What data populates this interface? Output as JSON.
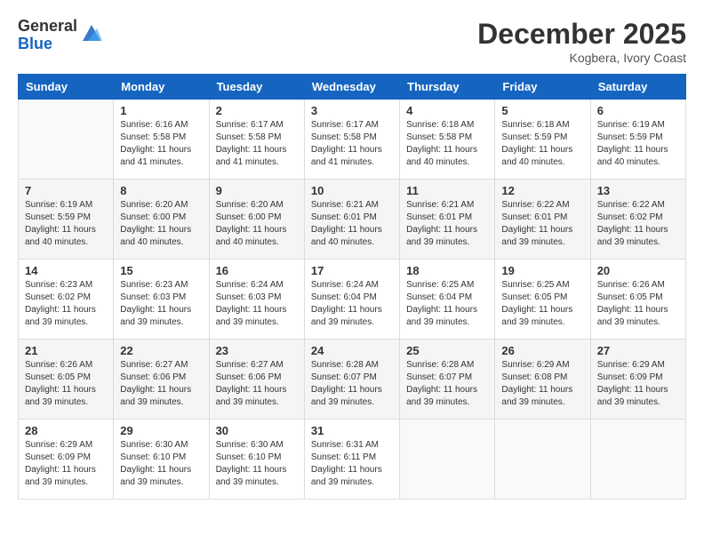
{
  "logo": {
    "general": "General",
    "blue": "Blue"
  },
  "header": {
    "month": "December 2025",
    "location": "Kogbera, Ivory Coast"
  },
  "weekdays": [
    "Sunday",
    "Monday",
    "Tuesday",
    "Wednesday",
    "Thursday",
    "Friday",
    "Saturday"
  ],
  "weeks": [
    [
      {
        "day": "",
        "info": ""
      },
      {
        "day": "1",
        "info": "Sunrise: 6:16 AM\nSunset: 5:58 PM\nDaylight: 11 hours and 41 minutes."
      },
      {
        "day": "2",
        "info": "Sunrise: 6:17 AM\nSunset: 5:58 PM\nDaylight: 11 hours and 41 minutes."
      },
      {
        "day": "3",
        "info": "Sunrise: 6:17 AM\nSunset: 5:58 PM\nDaylight: 11 hours and 41 minutes."
      },
      {
        "day": "4",
        "info": "Sunrise: 6:18 AM\nSunset: 5:58 PM\nDaylight: 11 hours and 40 minutes."
      },
      {
        "day": "5",
        "info": "Sunrise: 6:18 AM\nSunset: 5:59 PM\nDaylight: 11 hours and 40 minutes."
      },
      {
        "day": "6",
        "info": "Sunrise: 6:19 AM\nSunset: 5:59 PM\nDaylight: 11 hours and 40 minutes."
      }
    ],
    [
      {
        "day": "7",
        "info": "Sunrise: 6:19 AM\nSunset: 5:59 PM\nDaylight: 11 hours and 40 minutes."
      },
      {
        "day": "8",
        "info": "Sunrise: 6:20 AM\nSunset: 6:00 PM\nDaylight: 11 hours and 40 minutes."
      },
      {
        "day": "9",
        "info": "Sunrise: 6:20 AM\nSunset: 6:00 PM\nDaylight: 11 hours and 40 minutes."
      },
      {
        "day": "10",
        "info": "Sunrise: 6:21 AM\nSunset: 6:01 PM\nDaylight: 11 hours and 40 minutes."
      },
      {
        "day": "11",
        "info": "Sunrise: 6:21 AM\nSunset: 6:01 PM\nDaylight: 11 hours and 39 minutes."
      },
      {
        "day": "12",
        "info": "Sunrise: 6:22 AM\nSunset: 6:01 PM\nDaylight: 11 hours and 39 minutes."
      },
      {
        "day": "13",
        "info": "Sunrise: 6:22 AM\nSunset: 6:02 PM\nDaylight: 11 hours and 39 minutes."
      }
    ],
    [
      {
        "day": "14",
        "info": "Sunrise: 6:23 AM\nSunset: 6:02 PM\nDaylight: 11 hours and 39 minutes."
      },
      {
        "day": "15",
        "info": "Sunrise: 6:23 AM\nSunset: 6:03 PM\nDaylight: 11 hours and 39 minutes."
      },
      {
        "day": "16",
        "info": "Sunrise: 6:24 AM\nSunset: 6:03 PM\nDaylight: 11 hours and 39 minutes."
      },
      {
        "day": "17",
        "info": "Sunrise: 6:24 AM\nSunset: 6:04 PM\nDaylight: 11 hours and 39 minutes."
      },
      {
        "day": "18",
        "info": "Sunrise: 6:25 AM\nSunset: 6:04 PM\nDaylight: 11 hours and 39 minutes."
      },
      {
        "day": "19",
        "info": "Sunrise: 6:25 AM\nSunset: 6:05 PM\nDaylight: 11 hours and 39 minutes."
      },
      {
        "day": "20",
        "info": "Sunrise: 6:26 AM\nSunset: 6:05 PM\nDaylight: 11 hours and 39 minutes."
      }
    ],
    [
      {
        "day": "21",
        "info": "Sunrise: 6:26 AM\nSunset: 6:05 PM\nDaylight: 11 hours and 39 minutes."
      },
      {
        "day": "22",
        "info": "Sunrise: 6:27 AM\nSunset: 6:06 PM\nDaylight: 11 hours and 39 minutes."
      },
      {
        "day": "23",
        "info": "Sunrise: 6:27 AM\nSunset: 6:06 PM\nDaylight: 11 hours and 39 minutes."
      },
      {
        "day": "24",
        "info": "Sunrise: 6:28 AM\nSunset: 6:07 PM\nDaylight: 11 hours and 39 minutes."
      },
      {
        "day": "25",
        "info": "Sunrise: 6:28 AM\nSunset: 6:07 PM\nDaylight: 11 hours and 39 minutes."
      },
      {
        "day": "26",
        "info": "Sunrise: 6:29 AM\nSunset: 6:08 PM\nDaylight: 11 hours and 39 minutes."
      },
      {
        "day": "27",
        "info": "Sunrise: 6:29 AM\nSunset: 6:09 PM\nDaylight: 11 hours and 39 minutes."
      }
    ],
    [
      {
        "day": "28",
        "info": "Sunrise: 6:29 AM\nSunset: 6:09 PM\nDaylight: 11 hours and 39 minutes."
      },
      {
        "day": "29",
        "info": "Sunrise: 6:30 AM\nSunset: 6:10 PM\nDaylight: 11 hours and 39 minutes."
      },
      {
        "day": "30",
        "info": "Sunrise: 6:30 AM\nSunset: 6:10 PM\nDaylight: 11 hours and 39 minutes."
      },
      {
        "day": "31",
        "info": "Sunrise: 6:31 AM\nSunset: 6:11 PM\nDaylight: 11 hours and 39 minutes."
      },
      {
        "day": "",
        "info": ""
      },
      {
        "day": "",
        "info": ""
      },
      {
        "day": "",
        "info": ""
      }
    ]
  ]
}
